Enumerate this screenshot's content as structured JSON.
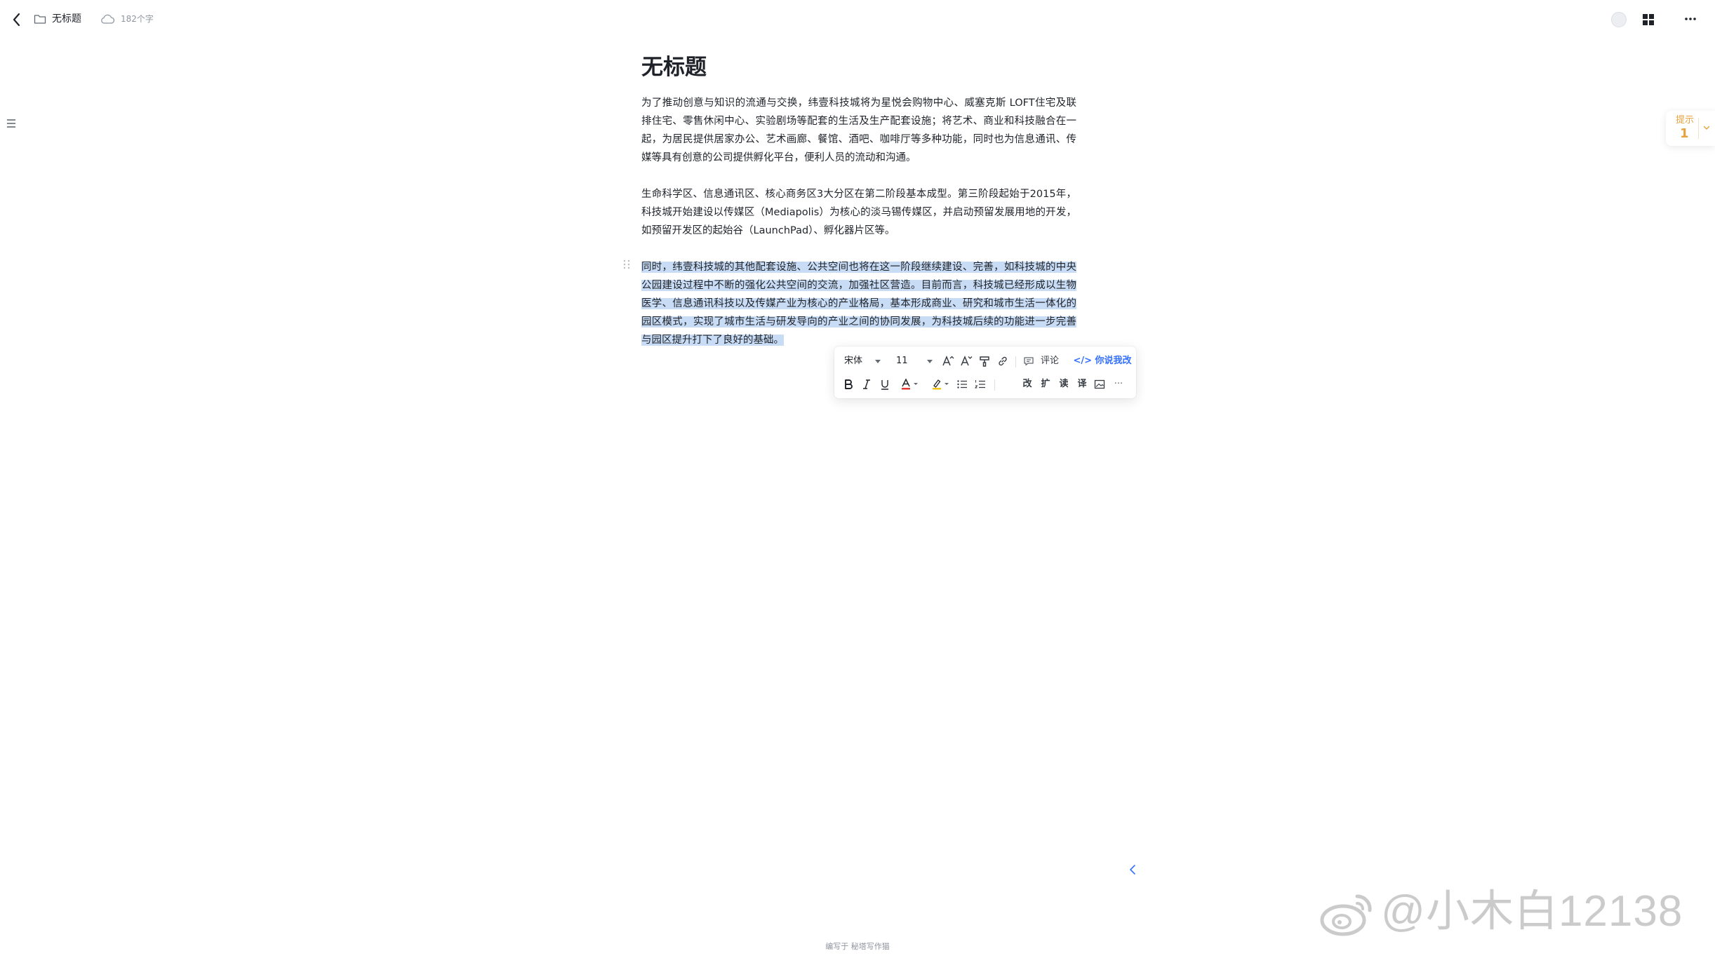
{
  "header": {
    "doc_name": "无标题",
    "word_count": "182个字"
  },
  "document": {
    "title": "无标题",
    "paragraphs": [
      "为了推动创意与知识的流通与交换，纬壹科技城将为星悦会购物中心、威塞克斯 LOFT住宅及联排住宅、零售休闲中心、实验剧场等配套的生活及生产配套设施；将艺术、商业和科技融合在一起，为居民提供居家办公、艺术画廊、餐馆、酒吧、咖啡厅等多种功能，同时也为信息通讯、传媒等具有创意的公司提供孵化平台，便利人员的流动和沟通。",
      "生命科学区、信息通讯区、核心商务区3大分区在第二阶段基本成型。第三阶段起始于2015年，科技城开始建设以传媒区（Mediapolis）为核心的淡马锡传媒区，并启动预留发展用地的开发，如预留开发区的起始谷（LaunchPad）、孵化器片区等。",
      "同时，纬壹科技城的其他配套设施、公共空间也将在这一阶段继续建设、完善，如科技城的中央公园建设过程中不断的强化公共空间的交流，加强社区营造。目前而言，科技城已经形成以生物医学、信息通讯科技以及传媒产业为核心的产业格局，基本形成商业、研究和城市生活一体化的园区模式，实现了城市生活与研发导向的产业之间的协同发展，为科技城后续的功能进一步完善与园区提升打下了良好的基础。"
    ]
  },
  "toolbar": {
    "font": "宋体",
    "size": "11",
    "comment_label": "评论",
    "ai_label": "你说我改",
    "ai_symbol": "</>",
    "rewrite_label": "改",
    "expand_label": "扩",
    "read_label": "读",
    "translate_label": "译",
    "more_label": "···",
    "text_color": "#e53935",
    "highlight_color": "#f5c518"
  },
  "hint": {
    "label": "提示",
    "count": "1"
  },
  "footer": {
    "note": "编写于 秘塔写作猫"
  },
  "watermark": {
    "text": "@小木白12138"
  },
  "colors": {
    "accent": "#3370ff",
    "selection": "#c9dcf5",
    "hint": "#e6a23c"
  }
}
